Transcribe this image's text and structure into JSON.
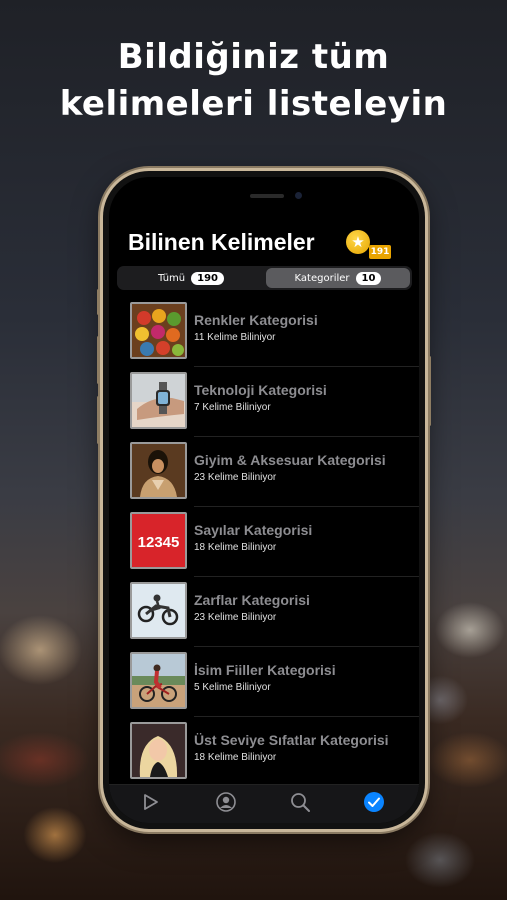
{
  "headline": {
    "line1": "Bildiğiniz tüm",
    "line2": "kelimeleri listeleyin"
  },
  "app": {
    "title": "Bilinen Kelimeler",
    "coin_icon": "star-coin-icon",
    "coin_badge": "191"
  },
  "segments": [
    {
      "label": "Tümü",
      "count": "190",
      "selected": false
    },
    {
      "label": "Kategoriler",
      "count": "10",
      "selected": true
    }
  ],
  "categories": [
    {
      "title": "Renkler Kategorisi",
      "subtitle": "11 Kelime Biliniyor",
      "image": "colored-balls"
    },
    {
      "title": "Teknoloji Kategorisi",
      "subtitle": "7 Kelime Biliniyor",
      "image": "smartwatch"
    },
    {
      "title": "Giyim & Aksesuar Kategorisi",
      "subtitle": "23 Kelime Biliniyor",
      "image": "clothing"
    },
    {
      "title": "Sayılar Kategorisi",
      "subtitle": "18 Kelime Biliniyor",
      "image": "numbers"
    },
    {
      "title": "Zarflar Kategorisi",
      "subtitle": "23 Kelime Biliniyor",
      "image": "motocross"
    },
    {
      "title": "İsim Fiiller Kategorisi",
      "subtitle": "5 Kelime Biliniyor",
      "image": "cyclist"
    },
    {
      "title": "Üst Seviye Sıfatlar Kategorisi",
      "subtitle": "18 Kelime Biliniyor",
      "image": "blonde-woman"
    }
  ],
  "thumb_text": {
    "numbers": "12345"
  },
  "tabbar": {
    "tabs": [
      {
        "icon": "play-icon",
        "active": false
      },
      {
        "icon": "profile-icon",
        "active": false
      },
      {
        "icon": "search-icon",
        "active": false
      },
      {
        "icon": "checkmark-circle-icon",
        "active": true
      }
    ]
  },
  "colors": {
    "accent": "#0a84ff",
    "coin": "#e9a400",
    "phone_frame": "#c9b79a"
  }
}
